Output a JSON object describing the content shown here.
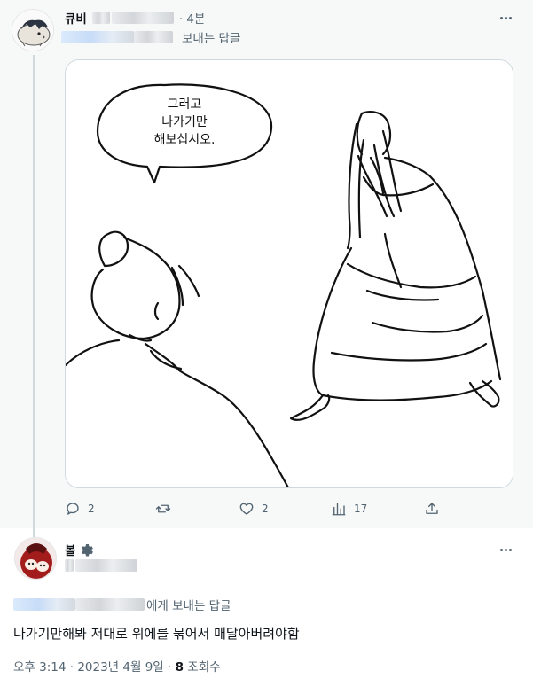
{
  "reply_tweet": {
    "author_name": "큐비",
    "time": "· 4분",
    "reply_label": "보내는 답글",
    "comic": {
      "speech_line1": "그러고",
      "speech_line2": "나가기만",
      "speech_line3": "해보십시오."
    },
    "actions": {
      "reply_icon": "comment-bubble-icon",
      "reply_count": "2",
      "retweet_icon": "retweet-icon",
      "like_icon": "heart-icon",
      "like_count": "2",
      "views_icon": "analytics-bars-icon",
      "views_count": "17",
      "share_icon": "share-upload-icon"
    }
  },
  "main_tweet": {
    "author_name": "볼",
    "badge_icon": "gear-badge-icon",
    "reply_label": "에게 보내는 답글",
    "text": "나가기만해봐 저대로 위에를 묶어서 매달아버려야함",
    "timestamp": "오후 3:14 · 2023년 4월 9일 · ",
    "views_number": "8",
    "views_label": " 조회수"
  },
  "colors": {
    "thread_bg": "#f7f9f9",
    "secondary_text": "#536471",
    "primary_text": "#0f1419",
    "border": "#cfd9de"
  }
}
